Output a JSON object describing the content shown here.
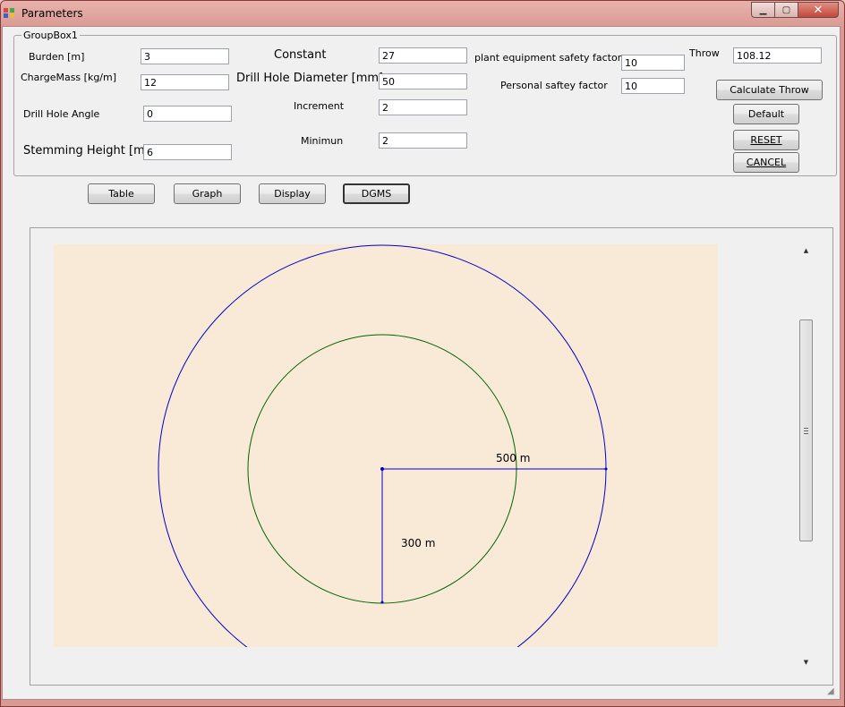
{
  "window": {
    "title": "Parameters"
  },
  "groupbox": {
    "legend": "GroupBox1"
  },
  "fields": {
    "burden": {
      "label": "Burden  [m]",
      "value": "3"
    },
    "charge_mass": {
      "label": "ChargeMass  [kg/m]",
      "value": "12"
    },
    "drill_hole_angle": {
      "label": "Drill Hole Angle",
      "value": "0"
    },
    "stemming_height": {
      "label": "Stemming Height [m]",
      "value": "6"
    },
    "constant": {
      "label": "Constant",
      "value": "27"
    },
    "drill_hole_diameter": {
      "label": "Drill Hole Diameter [mm]",
      "value": "50"
    },
    "increment": {
      "label": "Increment",
      "value": "2"
    },
    "minimum": {
      "label": "Minimun",
      "value": "2"
    },
    "plant_safety_factor": {
      "label": "plant equipment safety factor",
      "value": "10"
    },
    "personal_safety_factor": {
      "label": "Personal saftey factor",
      "value": "10"
    },
    "throw": {
      "label": "Throw",
      "value": "108.12"
    }
  },
  "buttons": {
    "calculate_throw": "Calculate Throw",
    "default": "Default",
    "reset": "RESET",
    "cancel": "CANCEL"
  },
  "view_tabs": [
    "Table",
    "Graph",
    "Display",
    "DGMS"
  ],
  "active_view": "DGMS",
  "diagram": {
    "outer_label": "500 m",
    "inner_label": "300 m",
    "outer_color": "#0000cc",
    "inner_color": "#006400",
    "background": "#f9ead7"
  }
}
